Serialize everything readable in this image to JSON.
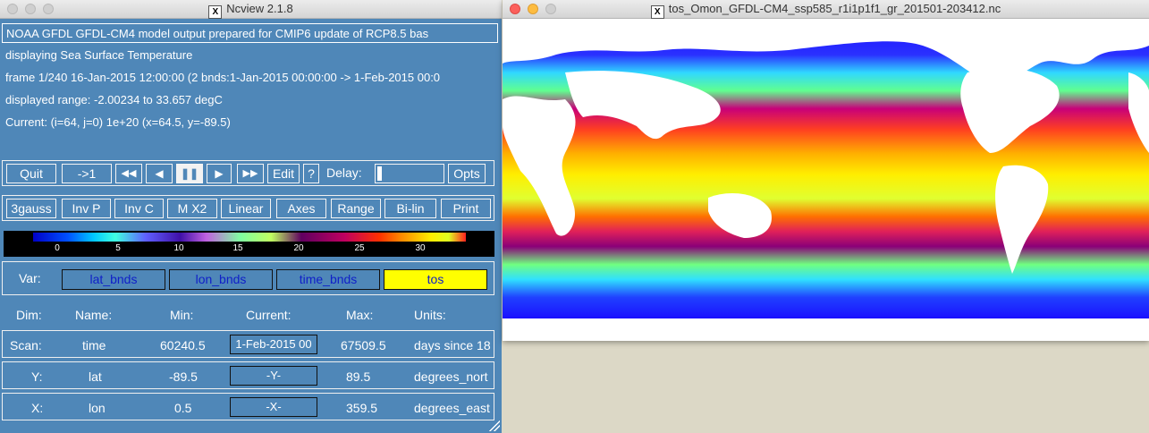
{
  "ncview": {
    "title": "Ncview 2.1.8",
    "info_lines": [
      "NOAA GFDL GFDL-CM4 model output prepared for CMIP6 update of RCP8.5 bas",
      "displaying Sea Surface Temperature",
      "frame 1/240 16-Jan-2015 12:00:00 (2 bnds:1-Jan-2015 00:00:00 -> 1-Feb-2015 00:0",
      "displayed range: -2.00234 to 33.657 degC",
      "Current: (i=64, j=0) 1e+20 (x=64.5, y=-89.5)"
    ],
    "controls": {
      "quit": "Quit",
      "step": "->1",
      "rewind": "◀◀",
      "back": "◀",
      "pause": "❚❚",
      "forward": "▶",
      "fast_forward": "▶▶",
      "edit": "Edit",
      "help": "?",
      "delay_label": "Delay:",
      "opts": "Opts",
      "delay_level": 0
    },
    "options": [
      "3gauss",
      "Inv P",
      "Inv C",
      "M X2",
      "Linear",
      "Axes",
      "Range",
      "Bi-lin",
      "Print"
    ],
    "colorbar_ticks": [
      "0",
      "5",
      "10",
      "15",
      "20",
      "25",
      "30"
    ],
    "var_label": "Var:",
    "vars": [
      "lat_bnds",
      "lon_bnds",
      "time_bnds",
      "tos"
    ],
    "selected_var": "tos",
    "dim_headers": [
      "Dim:",
      "Name:",
      "Min:",
      "Current:",
      "Max:",
      "Units:"
    ],
    "dims": [
      {
        "dim": "Scan:",
        "name": "time",
        "min": "60240.5",
        "current": "1-Feb-2015 00",
        "max": "67509.5",
        "units": "days since 18"
      },
      {
        "dim": "Y:",
        "name": "lat",
        "min": "-89.5",
        "current": "-Y-",
        "max": "89.5",
        "units": "degrees_nort"
      },
      {
        "dim": "X:",
        "name": "lon",
        "min": "0.5",
        "current": "-X-",
        "max": "359.5",
        "units": "degrees_east"
      }
    ]
  },
  "map_window": {
    "title": "tos_Omon_GFDL-CM4_ssp585_r1i1p1f1_gr_201501-203412.nc",
    "colors": {
      "land": "#ffffff",
      "tropical": "#ffee00",
      "warm": "#c0006a",
      "cold": "#1010ff"
    }
  }
}
